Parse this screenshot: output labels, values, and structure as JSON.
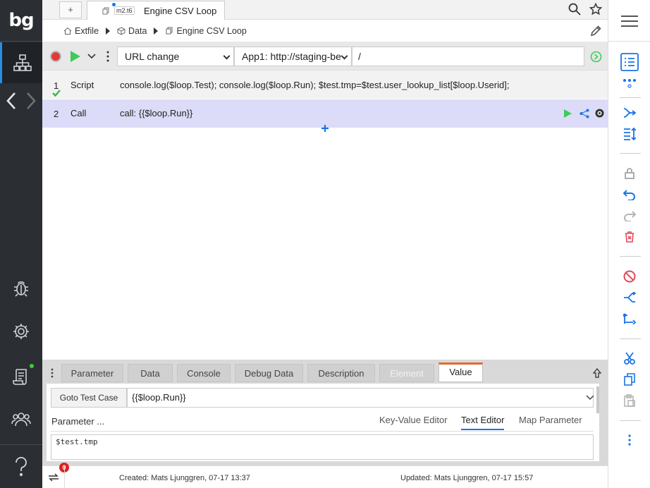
{
  "app": {
    "logo": "bg"
  },
  "tabs": {
    "new_tab": "+",
    "active": {
      "version": "m2.t6",
      "title": "Engine CSV Loop"
    }
  },
  "breadcrumb": [
    {
      "label": "Extfile",
      "icon": "home-icon"
    },
    {
      "label": "Data",
      "icon": "cubes-icon"
    },
    {
      "label": "Engine CSV Loop",
      "icon": "test-case-icon"
    }
  ],
  "urlbar": {
    "action": "URL change",
    "app": "App1: http://staging-be",
    "path": "/"
  },
  "steps": [
    {
      "num": "1",
      "type": "Script",
      "command": "console.log($loop.Test); console.log($loop.Run); $test.tmp=$test.user_lookup_list[$loop.Userid];",
      "status": "passed"
    },
    {
      "num": "2",
      "type": "Call",
      "command": "call: {{$loop.Run}}",
      "selected": true
    }
  ],
  "panel": {
    "tabs": [
      "Parameter",
      "Data",
      "Console",
      "Debug Data",
      "Description",
      "Element",
      "Value"
    ],
    "active_tab": "Value",
    "goto_label": "Goto Test Case",
    "value": "{{$loop.Run}}",
    "param_label": "Parameter ...",
    "editor_tabs": [
      "Key-Value Editor",
      "Text Editor",
      "Map Parameter"
    ],
    "active_editor": "Text Editor",
    "text": "$test.tmp"
  },
  "status": {
    "badge_count": "0",
    "created": "Created: Mats Ljunggren, 07-17 13:37",
    "updated": "Updated: Mats Ljunggren, 07-17 15:57"
  },
  "colors": {
    "accent": "#1a73e8",
    "play": "#3dcc5a",
    "record": "#e23a3a",
    "selected_row": "#dcdcf8",
    "active_tab_border": "#e56a2c"
  }
}
